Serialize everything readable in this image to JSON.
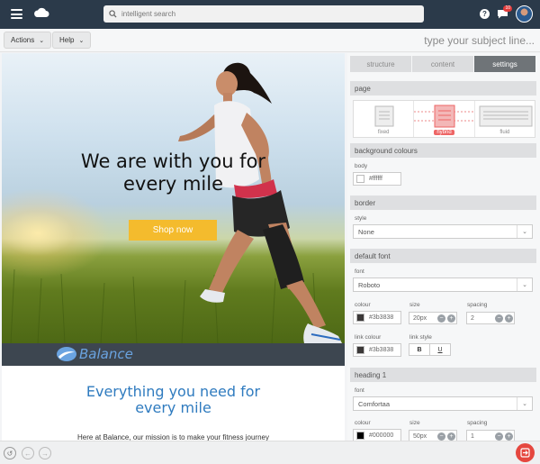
{
  "topbar": {
    "search_placeholder": "intelligent search",
    "notification_count": "10"
  },
  "toolbar": {
    "actions_label": "Actions",
    "help_label": "Help",
    "subject_placeholder": "type your subject line..."
  },
  "email": {
    "hero_title_line1": "We are with you for",
    "hero_title_line2": "every mile",
    "cta_label": "Shop now",
    "brand_name": "Balance",
    "section_title_line1": "Everything you need for",
    "section_title_line2": "every mile",
    "section_body": "Here at Balance, our mission is to make your fitness journey",
    "colors": {
      "cta": "#f4bb2d",
      "brand_bar": "#3d4650",
      "section_title": "#2f7bbf"
    }
  },
  "panel": {
    "tabs": [
      {
        "label": "structure"
      },
      {
        "label": "content"
      },
      {
        "label": "settings"
      }
    ],
    "page": {
      "header": "page",
      "layouts": [
        {
          "label": "fixed"
        },
        {
          "label": "hybrid"
        },
        {
          "label": "fluid"
        }
      ]
    },
    "background": {
      "header": "background colours",
      "body_label": "body",
      "body_value": "#ffffff"
    },
    "border": {
      "header": "border",
      "style_label": "style",
      "style_value": "None"
    },
    "default_font": {
      "header": "default font",
      "font_label": "font",
      "font_value": "Roboto",
      "colour_label": "colour",
      "colour_value": "#3b3838",
      "size_label": "size",
      "size_value": "20px",
      "spacing_label": "spacing",
      "spacing_value": "2",
      "link_colour_label": "link colour",
      "link_colour_value": "#3b3838",
      "link_style_label": "link style",
      "bold_label": "B",
      "underline_label": "U"
    },
    "heading1": {
      "header": "heading 1",
      "font_label": "font",
      "font_value": "Comfortaa",
      "colour_label": "colour",
      "colour_value": "#000000",
      "size_label": "size",
      "size_value": "50px",
      "spacing_label": "spacing",
      "spacing_value": "1"
    }
  }
}
